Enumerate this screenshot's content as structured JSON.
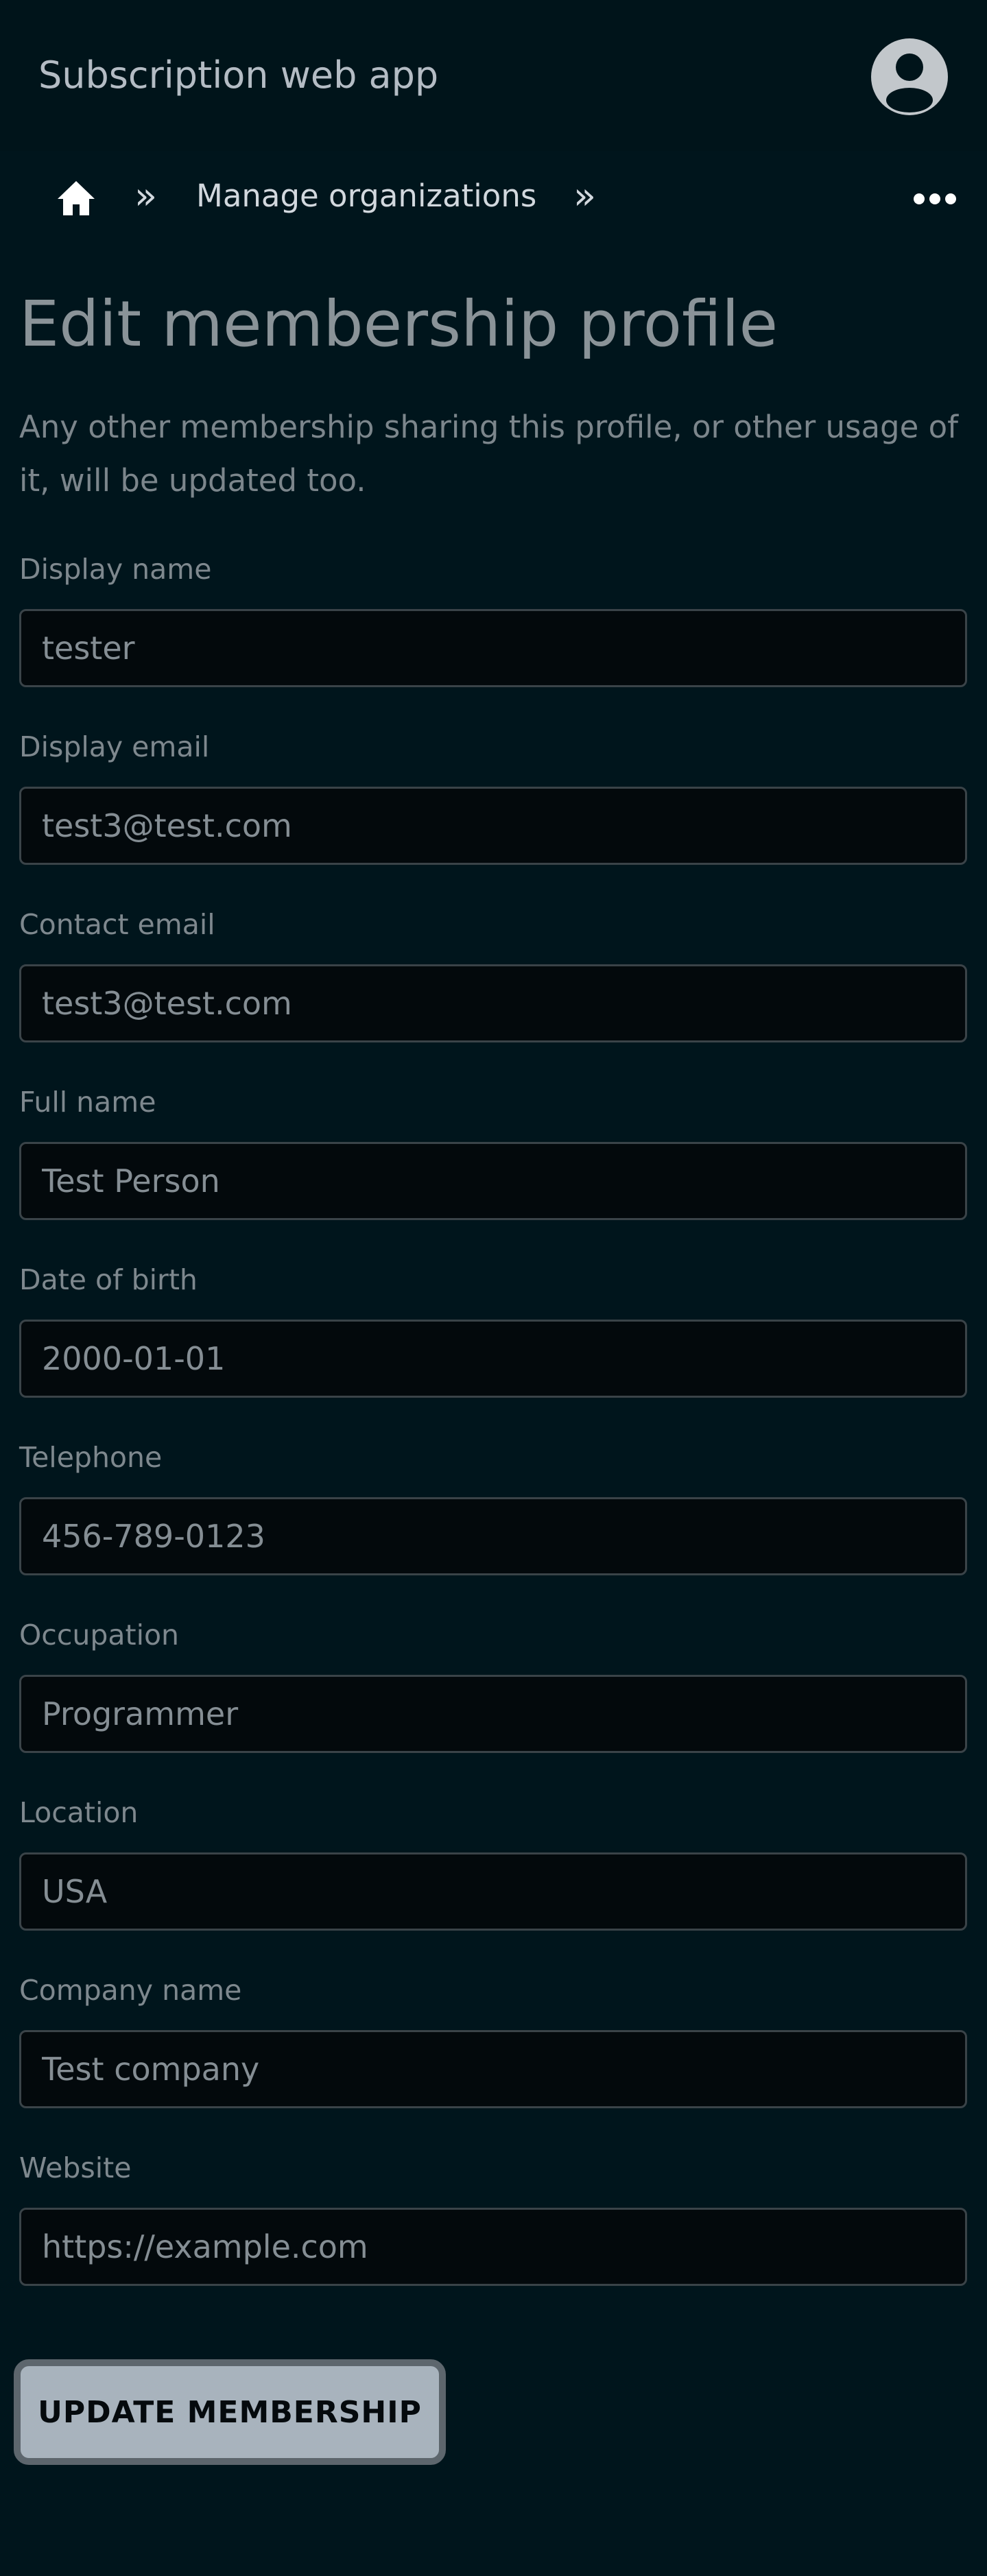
{
  "app": {
    "title": "Subscription web app"
  },
  "header": {
    "account_icon": "account-circle-icon"
  },
  "breadcrumb": {
    "home_icon": "home-icon",
    "separator": "»",
    "items": [
      {
        "label": "Manage organizations"
      }
    ],
    "more_icon": "more-horizontal-icon"
  },
  "page": {
    "title": "Edit membership profile",
    "description": "Any other membership sharing this profile, or other usage of it, will be updated too."
  },
  "form": {
    "fields": [
      {
        "label": "Display name",
        "value": "tester"
      },
      {
        "label": "Display email",
        "value": "test3@test.com"
      },
      {
        "label": "Contact email",
        "value": "test3@test.com"
      },
      {
        "label": "Full name",
        "value": "Test Person"
      },
      {
        "label": "Date of birth",
        "value": "2000-01-01"
      },
      {
        "label": "Telephone",
        "value": "456-789-0123"
      },
      {
        "label": "Occupation",
        "value": "Programmer"
      },
      {
        "label": "Location",
        "value": "USA"
      },
      {
        "label": "Company name",
        "value": "Test company"
      },
      {
        "label": "Website",
        "value": "https://example.com"
      }
    ],
    "submit_label": "UPDATE MEMBERSHIP"
  },
  "colors": {
    "background": "#00151c",
    "input_background": "#03090c",
    "button_background": "#a8b3bd"
  }
}
